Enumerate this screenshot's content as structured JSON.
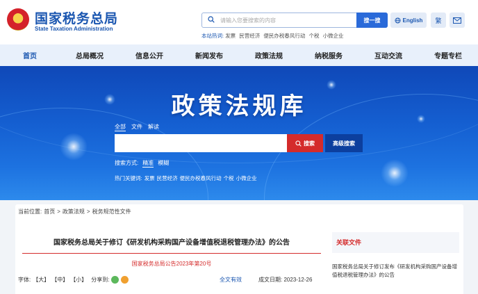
{
  "header": {
    "site_title": "国家税务总局",
    "site_subtitle": "State Taxation Administration",
    "search_placeholder": "请输入您要搜索的内容",
    "search_button": "搜一搜",
    "hotwords_label": "本站热词:",
    "hotwords": [
      "发票",
      "民营经济",
      "便民办税春风行动",
      "个税",
      "小微企业"
    ],
    "english_button": "English",
    "traditional_button": "繁"
  },
  "nav": {
    "items": [
      "首页",
      "总局概况",
      "信息公开",
      "新闻发布",
      "政策法规",
      "纳税服务",
      "互动交流",
      "专题专栏"
    ]
  },
  "banner": {
    "title": "政策法规库",
    "scope_tabs": [
      "全部",
      "文件",
      "解读"
    ],
    "search_button": "搜索",
    "advanced_search": "高级搜索",
    "mode_label": "搜索方式:",
    "mode_options": [
      "精准",
      "模糊"
    ],
    "hot_label": "热门关键词:",
    "hot_keywords": [
      "发票",
      "民营经济",
      "便民办税春风行动",
      "个税",
      "小微企业"
    ]
  },
  "breadcrumb": {
    "label": "当前位置:",
    "items": [
      "首页",
      "政策法规",
      "税务规范性文件"
    ],
    "separator": ">"
  },
  "article": {
    "title": "国家税务总局关于修订《研发机构采购国产设备增值税退税管理办法》的公告",
    "doc_number": "国家税务总局公告2023年第20号",
    "font_label": "字体:",
    "font_sizes": [
      "【大】",
      "【中】",
      "【小】"
    ],
    "share_label": "分享到:",
    "validity": "全文有效",
    "date_label": "成文日期:",
    "date": "2023-12-26"
  },
  "related": {
    "title": "关联文件",
    "items": [
      "国家税务总局关于修订发布《研发机构采购国产设备增值税退税管理办法》的公告"
    ]
  },
  "colors": {
    "brand_blue": "#1a56b0",
    "accent_red": "#d42b2b",
    "nav_bg": "#e8f0fb"
  }
}
